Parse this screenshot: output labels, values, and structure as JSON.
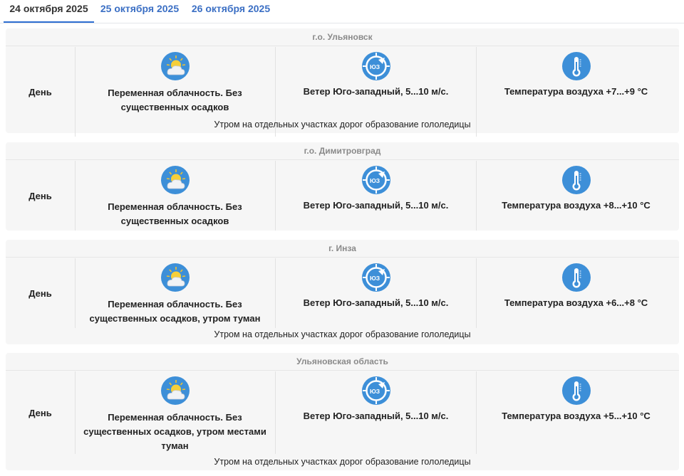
{
  "tabs": [
    {
      "label": "24 октября 2025",
      "active": true
    },
    {
      "label": "25 октября 2025",
      "active": false
    },
    {
      "label": "26 октября 2025",
      "active": false
    }
  ],
  "colors": {
    "accent": "#2f6fd1",
    "icon_blue": "#3d8fd8",
    "card_bg": "#f6f6f6"
  },
  "wind_badge": "ЮЗ",
  "regions": [
    {
      "title": "г.о. Ульяновск",
      "period": "День",
      "sky": "Переменная облачность. Без существенных осадков",
      "wind": "Ветер Юго-западный, 5...10 м/с.",
      "temp": "Температура воздуха +7...+9 °С",
      "note": "Утром на отдельных участках дорог образование гололедицы",
      "icons": [
        "partly-cloudy-icon",
        "wind-direction-icon",
        "thermometer-icon"
      ]
    },
    {
      "title": "г.о. Димитровград",
      "period": "День",
      "sky": "Переменная облачность. Без существенных осадков",
      "wind": "Ветер Юго-западный, 5...10 м/с.",
      "temp": "Температура воздуха +8...+10 °С",
      "note": "",
      "icons": [
        "partly-cloudy-icon",
        "wind-direction-icon",
        "thermometer-icon"
      ]
    },
    {
      "title": "г. Инза",
      "period": "День",
      "sky": "Переменная облачность. Без существенных осадков, утром туман",
      "wind": "Ветер Юго-западный, 5...10 м/с.",
      "temp": "Температура воздуха +6...+8 °С",
      "note": "Утром на отдельных участках дорог образование гололедицы",
      "icons": [
        "partly-cloudy-icon",
        "wind-direction-icon",
        "thermometer-icon"
      ]
    },
    {
      "title": "Ульяновская область",
      "period": "День",
      "sky": "Переменная облачность. Без существенных осадков, утром местами туман",
      "wind": "Ветер Юго-западный, 5...10 м/с.",
      "temp": "Температура воздуха +5...+10 °С",
      "note": "Утром на отдельных участках дорог образование гололедицы",
      "icons": [
        "partly-cloudy-icon",
        "wind-direction-icon",
        "thermometer-icon"
      ]
    }
  ]
}
